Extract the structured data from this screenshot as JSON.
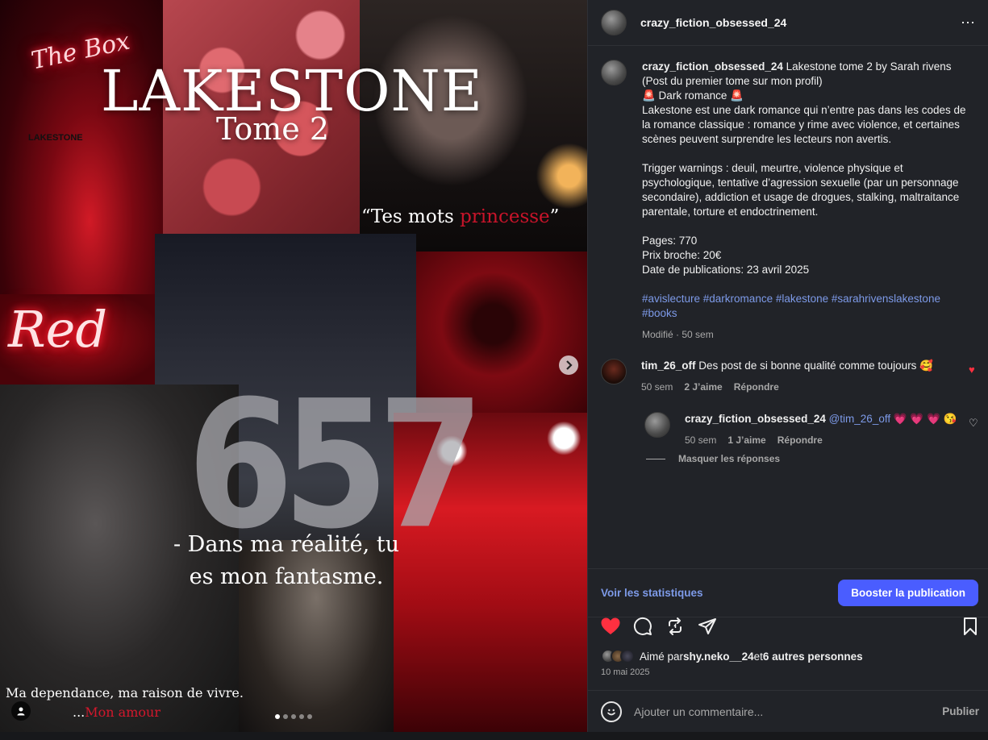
{
  "media": {
    "neon_the_box": "The Box",
    "small_label": "LAKESTONE",
    "title": "LAKESTONE",
    "subtitle": "Tome 2",
    "quote_open": "“Tes mots ",
    "quote_accent": "princesse",
    "quote_close": "”",
    "neon_red": "Red",
    "big_number": "657",
    "quote2": "- Dans ma réalité, tu es mon fantasme.",
    "bottom_line1": "Ma dependance, ma raison de vivre.",
    "bottom_line2_prefix": "...",
    "bottom_line2_accent": "Mon amour",
    "carousel_dots": 5,
    "active_dot": 0
  },
  "header": {
    "username": "crazy_fiction_obsessed_24",
    "more_icon": "⋯"
  },
  "caption": {
    "username": "crazy_fiction_obsessed_24",
    "first_line": " Lakestone tome 2 by Sarah rivens",
    "line2": "(Post du premier tome sur mon profil)",
    "line3": "🚨 Dark romance 🚨",
    "paragraph1": "Lakestone est une dark romance qui n’entre pas dans les codes de la romance classique : romance y rime avec violence, et certaines scènes peuvent surprendre les lecteurs non avertis.",
    "paragraph2": "Trigger warnings : deuil, meurtre, violence physique et psychologique, tentative d’agression sexuelle (par un personnage secondaire), addiction et usage de drogues, stalking, maltraitance parentale, torture et endoctrinement.",
    "pages": "Pages: 770",
    "price": "Prix broche: 20€",
    "date": "Date de publications: 23 avril 2025",
    "hashtags": "#avislecture #darkromance #lakestone #sarahrivenslakestone #books",
    "edited": "Modifié · 50 sem"
  },
  "comments": [
    {
      "username": "tim_26_off",
      "text": " Des post de si bonne qualité comme toujours 🥰",
      "time": "50 sem",
      "likes": "2 J’aime",
      "reply": "Répondre"
    }
  ],
  "reply": {
    "username": "crazy_fiction_obsessed_24",
    "mention": " @tim_26_off",
    "text": " 💗 💗 💗 😘",
    "time": "50 sem",
    "likes": "1 J’aime",
    "reply": "Répondre"
  },
  "hide_replies": "Masquer les réponses",
  "stats_link": "Voir les statistiques",
  "boost_button": "Booster la publication",
  "likes": {
    "prefix": "Aimé par ",
    "user": "shy.neko__24",
    "middle": " et ",
    "others": "6 autres personnes"
  },
  "post_date": "10 mai 2025",
  "comment_box": {
    "placeholder": "Ajouter un commentaire...",
    "publish": "Publier"
  },
  "colors": {
    "like_red": "#ff3040",
    "link_blue": "#7d9ae8",
    "boost_blue": "#4a5dff",
    "panel_bg": "#212328"
  }
}
